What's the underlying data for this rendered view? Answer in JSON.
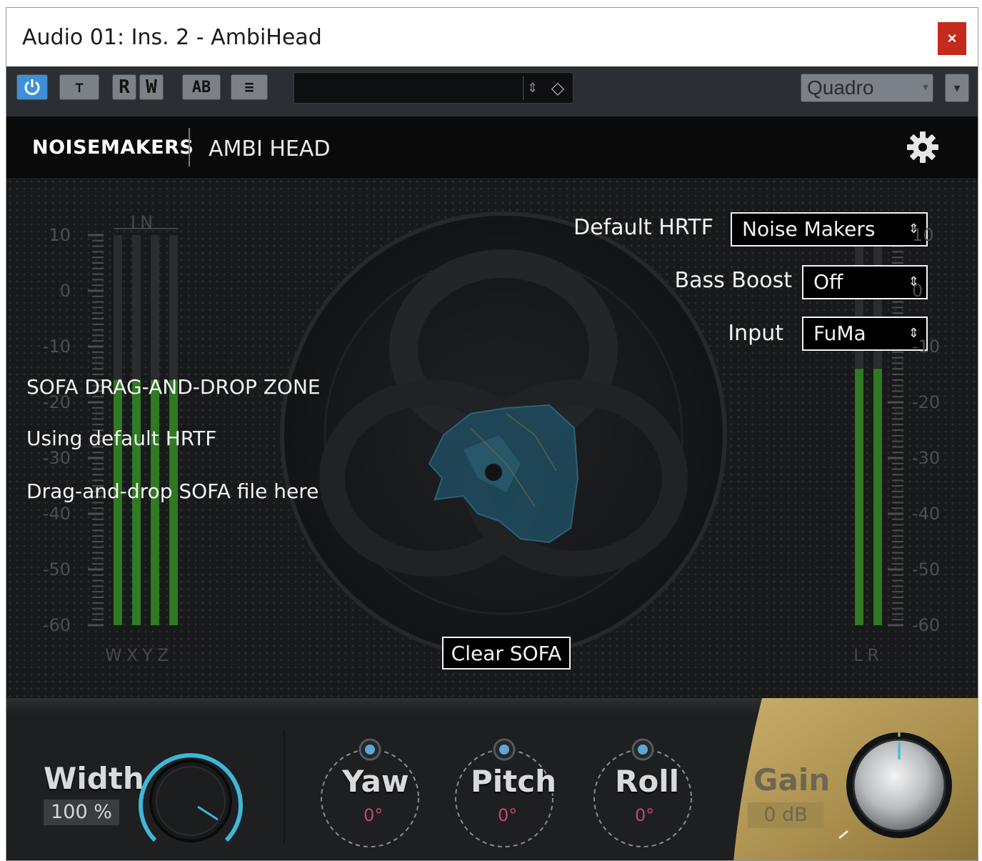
{
  "window": {
    "title": "Audio 01: Ins. 2 - AmbiHead",
    "close_label": "×"
  },
  "toolbar": {
    "power_icon": "power-icon",
    "buttons": [
      "⊤",
      "R",
      "W",
      "AB",
      "≡"
    ],
    "preset_value": "",
    "preset_arrows": "⇕",
    "preset_diamond": "◇",
    "output_select": "Quadro",
    "output_arrow": "▾",
    "menu_arrow": "▾"
  },
  "header": {
    "brand": "NOISEMAKERS",
    "product": "AMBI HEAD",
    "settings_icon": "gear-icon"
  },
  "meters": {
    "in_label": "IN",
    "scale": [
      "10",
      "0",
      "-10",
      "-20",
      "-30",
      "-40",
      "-50",
      "-60"
    ],
    "input_channels": "WXYZ",
    "output_channels": "LR",
    "input_levels_db": [
      -16,
      -16,
      -16,
      -16
    ],
    "output_levels_db": [
      -14,
      -14
    ]
  },
  "settings": {
    "default_hrtf_label": "Default HRTF",
    "default_hrtf_value": "Noise Makers",
    "bass_boost_label": "Bass Boost",
    "bass_boost_value": "Off",
    "input_label": "Input",
    "input_value": "FuMa",
    "select_arrow": "⇕"
  },
  "sofa": {
    "zone_title": "SOFA DRAG-AND-DROP ZONE",
    "status": "Using default HRTF",
    "hint": "Drag-and-drop SOFA file here",
    "clear_button": "Clear SOFA"
  },
  "controls": {
    "width_label": "Width",
    "width_value": "100 %",
    "yaw_label": "Yaw",
    "yaw_value": "0°",
    "pitch_label": "Pitch",
    "pitch_value": "0°",
    "roll_label": "Roll",
    "roll_value": "0°",
    "gain_label": "Gain",
    "gain_value": "0 dB"
  },
  "colors": {
    "accent": "#3e8fd6",
    "meter_green": "#2f7a22",
    "knob_ring": "#3fb7d6",
    "gain_gold": "#b89a52",
    "value_pink": "#c04a6a"
  }
}
